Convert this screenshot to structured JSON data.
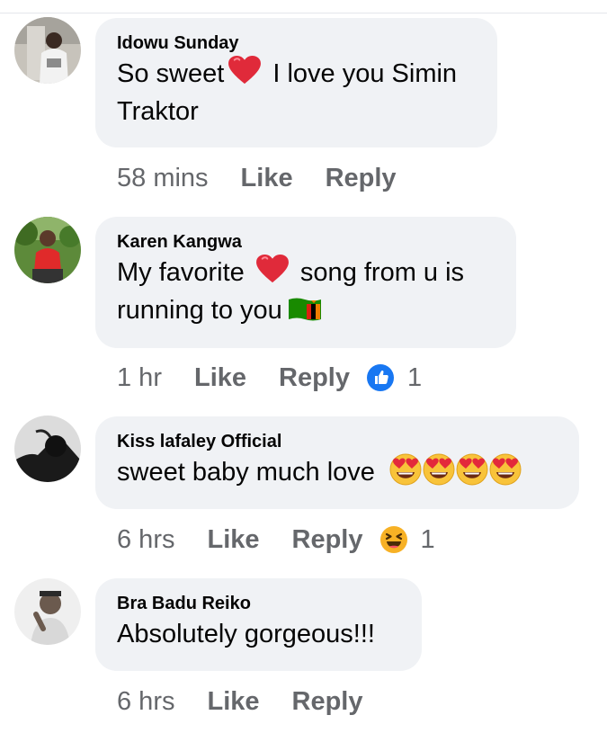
{
  "comments": [
    {
      "author": "Idowu Sunday",
      "text_before": "So sweet",
      "text_after": " I love you Simin Traktor",
      "time": "58 mins",
      "like_label": "Like",
      "reply_label": "Reply",
      "inline_emoji": [
        "red-heart"
      ]
    },
    {
      "author": "Karen Kangwa",
      "text_before": "My favorite ",
      "text_middle": " song from u is running to you",
      "time": "1 hr",
      "like_label": "Like",
      "reply_label": "Reply",
      "inline_emoji": [
        "red-heart",
        "zambia-flag"
      ],
      "reaction": {
        "icon": "thumbs-up-icon",
        "count": "1",
        "color": "#1877f2"
      }
    },
    {
      "author": "Kiss lafaley Official",
      "text_before": "sweet baby much love",
      "time": "6 hrs",
      "like_label": "Like",
      "reply_label": "Reply",
      "inline_emoji": [
        "heart-eyes",
        "heart-eyes",
        "heart-eyes",
        "heart-eyes"
      ],
      "reaction": {
        "icon": "haha-icon",
        "count": "1",
        "color": "#f7b125"
      }
    },
    {
      "author": "Bra Badu Reiko",
      "text_before": "Absolutely gorgeous!!!",
      "time": "6 hrs",
      "like_label": "Like",
      "reply_label": "Reply"
    }
  ],
  "colors": {
    "bubble": "#f0f2f5",
    "secondary_text": "#65676b",
    "primary_text": "#050505",
    "heart": "#e02a3a"
  }
}
